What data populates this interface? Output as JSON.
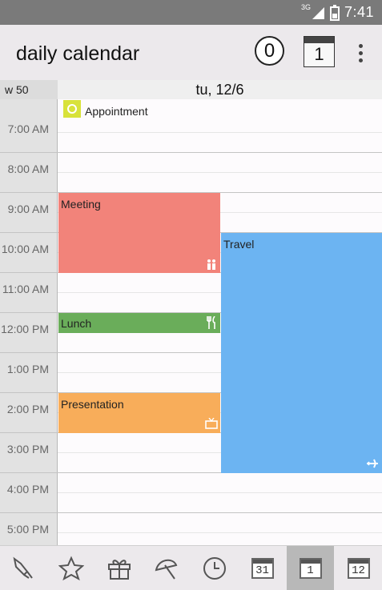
{
  "status_bar": {
    "network": "3G",
    "time": "7:41"
  },
  "app_bar": {
    "title": "daily calendar",
    "count_badge": "0",
    "today_button": "1"
  },
  "header": {
    "week": "w 50",
    "date": "tu, 12/6"
  },
  "hours": [
    "7:00 AM",
    "8:00 AM",
    "9:00 AM",
    "10:00 AM",
    "11:00 AM",
    "12:00 PM",
    "1:00 PM",
    "2:00 PM",
    "3:00 PM",
    "4:00 PM",
    "5:00 PM"
  ],
  "all_day_event": {
    "label": "Appointment",
    "icon": "clock-icon",
    "color": "#d8e23a"
  },
  "events": [
    {
      "label": "Meeting",
      "color": "#f2837a",
      "icon": "people-icon"
    },
    {
      "label": "Travel",
      "color": "#6cb4f2",
      "icon": "airplane-icon"
    },
    {
      "label": "Lunch",
      "color": "#6aad5a",
      "icon": "fork-knife-icon"
    },
    {
      "label": "Presentation",
      "color": "#f8ad5a",
      "icon": "tv-icon"
    }
  ],
  "bottom_nav": [
    {
      "icon": "pen-icon"
    },
    {
      "icon": "star-icon"
    },
    {
      "icon": "gift-icon"
    },
    {
      "icon": "umbrella-icon"
    },
    {
      "icon": "clock-icon"
    },
    {
      "icon": "month-view-icon",
      "label": "31"
    },
    {
      "icon": "day-view-icon",
      "label": "1",
      "active": true
    },
    {
      "icon": "year-view-icon",
      "label": "12"
    }
  ]
}
